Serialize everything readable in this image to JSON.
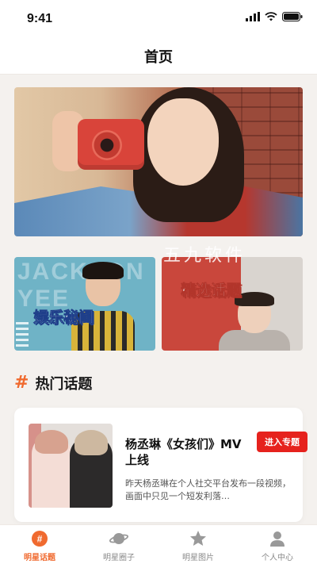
{
  "status_bar": {
    "time": "9:41"
  },
  "nav": {
    "title": "首页"
  },
  "banner": {
    "side_text_left": "",
    "side_text_right": ""
  },
  "tiles": [
    {
      "label": "娱乐秘闻",
      "bg_text_1": "JACKSON",
      "bg_text_2": "YEE"
    },
    {
      "label": "精选话题"
    }
  ],
  "watermark": "五九软件",
  "section": {
    "title": "热门话题",
    "icon": "hash-icon"
  },
  "topic_card": {
    "title": "杨丞琳《女孩们》MV上线",
    "button_label": "进入专题",
    "description": "昨天杨丞琳在个人社交平台发布一段视频，画面中只见一个短发利落…"
  },
  "tabbar": {
    "items": [
      {
        "label": "明星话题",
        "icon": "hash-badge-icon",
        "active": true
      },
      {
        "label": "明星圈子",
        "icon": "planet-icon",
        "active": false
      },
      {
        "label": "明星图片",
        "icon": "star-icon",
        "active": false
      },
      {
        "label": "个人中心",
        "icon": "user-icon",
        "active": false
      }
    ]
  },
  "colors": {
    "accent": "#f06a2f",
    "button_red": "#e6221d",
    "page_bg": "#f4f1ee"
  }
}
